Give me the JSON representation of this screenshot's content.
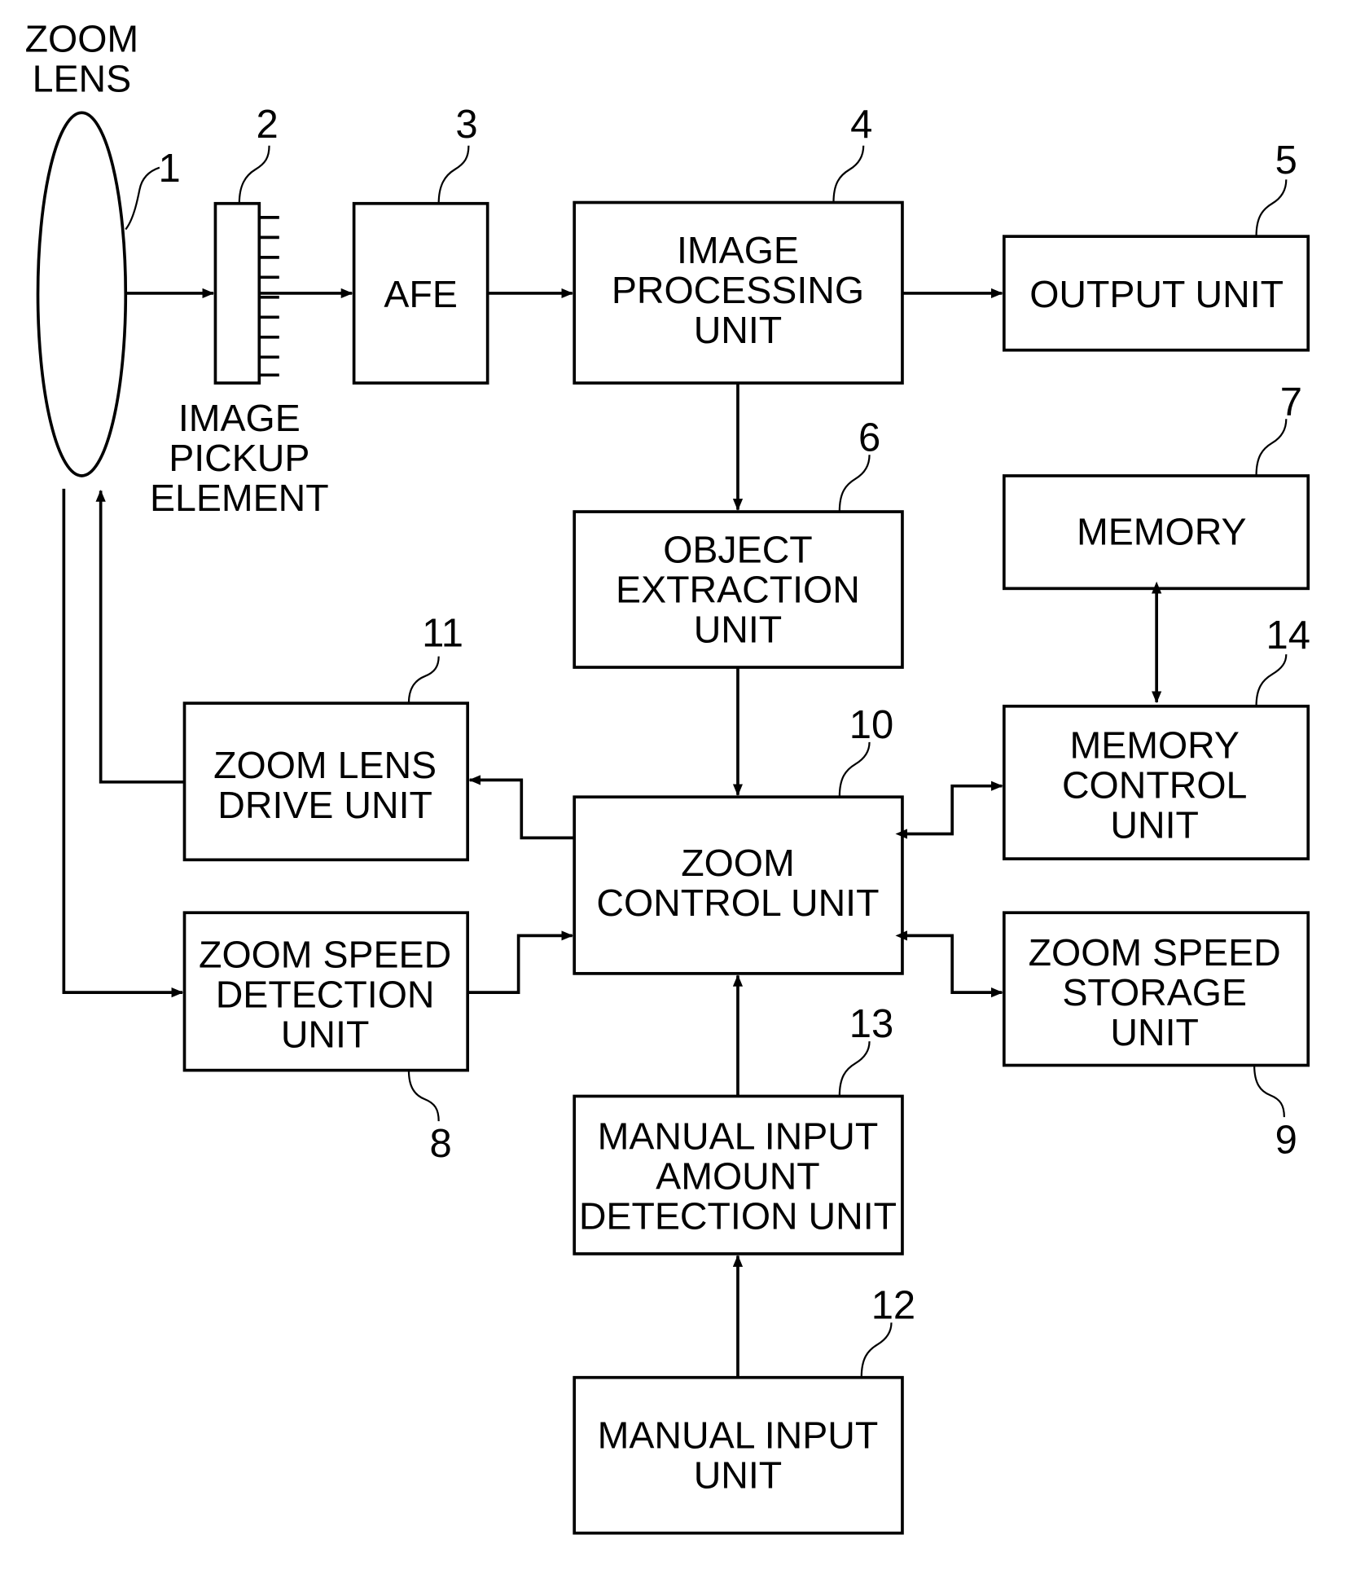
{
  "diagram": {
    "lens": {
      "label": [
        "ZOOM",
        "LENS"
      ],
      "ref": "1"
    },
    "pickup": {
      "label": [
        "IMAGE",
        "PICKUP",
        "ELEMENT"
      ],
      "ref": "2"
    },
    "blocks": {
      "afe": {
        "label": [
          "AFE"
        ],
        "ref": "3"
      },
      "image_processing": {
        "label": [
          "IMAGE",
          "PROCESSING",
          "UNIT"
        ],
        "ref": "4"
      },
      "output": {
        "label": [
          "OUTPUT UNIT"
        ],
        "ref": "5"
      },
      "object_extraction": {
        "label": [
          "OBJECT",
          "EXTRACTION",
          "UNIT"
        ],
        "ref": "6"
      },
      "memory": {
        "label": [
          "MEMORY"
        ],
        "ref": "7"
      },
      "zoom_speed_detection": {
        "label": [
          "ZOOM SPEED",
          "DETECTION",
          "UNIT"
        ],
        "ref": "8"
      },
      "zoom_speed_storage": {
        "label": [
          "ZOOM SPEED",
          "STORAGE",
          "UNIT"
        ],
        "ref": "9"
      },
      "zoom_control": {
        "label": [
          "ZOOM",
          "CONTROL UNIT"
        ],
        "ref": "10"
      },
      "zoom_lens_drive": {
        "label": [
          "ZOOM LENS",
          "DRIVE UNIT"
        ],
        "ref": "11"
      },
      "manual_input": {
        "label": [
          "MANUAL INPUT",
          "UNIT"
        ],
        "ref": "12"
      },
      "manual_input_amount": {
        "label": [
          "MANUAL INPUT",
          "AMOUNT",
          "DETECTION UNIT"
        ],
        "ref": "13"
      },
      "memory_control": {
        "label": [
          "MEMORY",
          "CONTROL",
          "UNIT"
        ],
        "ref": "14"
      }
    }
  }
}
